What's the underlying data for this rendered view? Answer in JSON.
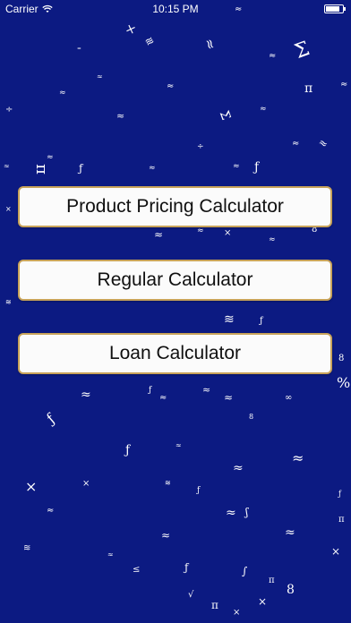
{
  "status_bar": {
    "carrier": "Carrier",
    "time": "10:15 PM"
  },
  "buttons": {
    "product_pricing": "Product Pricing Calculator",
    "regular": "Regular Calculator",
    "loan": "Loan Calculator"
  },
  "background": {
    "symbols": [
      "≈",
      "×",
      "≋",
      "≈",
      "≈",
      "⁼",
      "Σ",
      "≈",
      "≈",
      "π",
      "≈",
      "≈",
      "÷",
      "≈",
      "Σ",
      "≈",
      "≈",
      "÷",
      "≈",
      "≈",
      "≈",
      "π",
      "ƒ",
      "≈",
      "≈",
      "×",
      "ƒ",
      "≈",
      "≈",
      "×",
      "8",
      "≈",
      "≋",
      "≋",
      "≈",
      "ƒ",
      "8",
      "≈",
      "ƒ",
      "≈",
      "≈",
      "∞",
      "ƒ",
      "%",
      "8",
      "ƒ",
      "≈",
      "≈",
      "×",
      "≈",
      "×",
      "≈",
      "ƒ",
      "≋",
      "ƒ",
      "≈",
      "ʃ",
      "≈",
      "≋",
      "≈",
      "≤",
      "ƒ",
      "∫",
      "8",
      "×",
      "π",
      "π",
      "×",
      "π",
      "×",
      "√",
      "≈"
    ]
  },
  "colors": {
    "background": "#0c1a82",
    "button_bg": "#fbfbfb",
    "button_border": "#c8a35a",
    "button_text": "#101010"
  }
}
